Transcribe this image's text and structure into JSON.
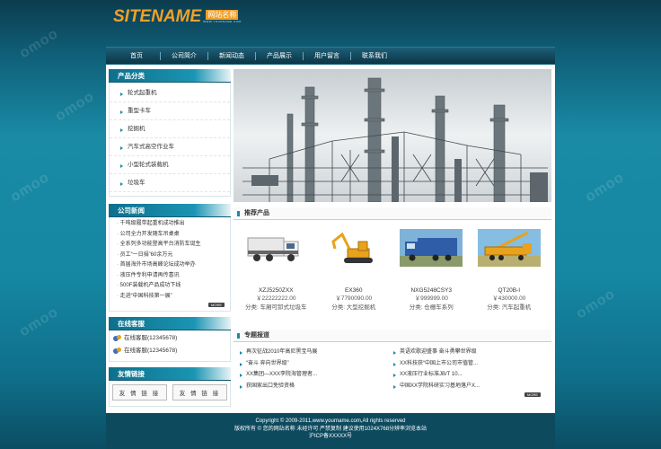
{
  "logo": {
    "main": "SITENAME",
    "cn": "网站名称",
    "sub": "WWW.YOURNAME.COM"
  },
  "nav": [
    "首页",
    "公司简介",
    "新闻动态",
    "产品展示",
    "用户留言",
    "联系我们"
  ],
  "watermark": "omoo",
  "sidebar": {
    "categories": {
      "title": "产品分类",
      "items": [
        "轮式起重机",
        "重型卡车",
        "挖掘机",
        "汽车式高空作业车",
        "小型轮式装载机",
        "垃圾车"
      ]
    },
    "news": {
      "title": "公司新闻",
      "items": [
        "千吨级履带起重机成功推出",
        "公司全力开发随车吊桌桌",
        "全系列多功能登高平台消防车诞生",
        "员工“一日捐”60余万元",
        "首届海外市场高峰论坛成功举办",
        "液压件专利申请再传喜讯",
        "500F装载机产品成功下线",
        "走进“中国科技第一展”"
      ],
      "more": "MORE"
    },
    "online": {
      "title": "在线客服",
      "items": [
        "在线客服(12345678)",
        "在线客服(12345678)"
      ]
    },
    "links": {
      "title": "友情链接",
      "items": [
        "友 情 链 接",
        "友 情 链 接"
      ]
    }
  },
  "recommend": {
    "title": "推荐产品",
    "products": [
      {
        "name": "XZJ5250ZXX",
        "price": "￥22222222.00",
        "cat": "分类: 车厢可卸式垃圾车"
      },
      {
        "name": "EX360",
        "price": "￥7790090.00",
        "cat": "分类: 大型挖掘机"
      },
      {
        "name": "NXG5248CSY3",
        "price": "￥999999.00",
        "cat": "分类: 仓栅车系列"
      },
      {
        "name": "QT20B-I",
        "price": "￥430000.00",
        "cat": "分类: 汽车起重机"
      }
    ]
  },
  "topics": {
    "title": "专题报道",
    "left": [
      "再次征战2010年高尼黑宝马展",
      "“奋斗 奔向世界级”",
      "XX集团—XXX李院海管理者...",
      "获国家出口免验资格"
    ],
    "right": [
      "英语欢歌迎盛事 奋斗勇攀世界级",
      "XX科技获“中国上市公司市值管...",
      "XX液压行业标准JB/T 10...",
      "中国XX学院科研实习基地落户X..."
    ],
    "more": "MORE"
  },
  "footer": {
    "line1": "Copyright © 2009-2011,www.yourname.com,All rights reserved",
    "line2": "版权所有 © 您的网站名称 未经许可 严禁复制 建议使用1024X768分辨率浏览本站",
    "line3": "沪ICP备XXXXX号"
  },
  "colors": {
    "accent": "#1a8aa5",
    "logo": "#f0a02a",
    "nav": "#0b3646"
  }
}
